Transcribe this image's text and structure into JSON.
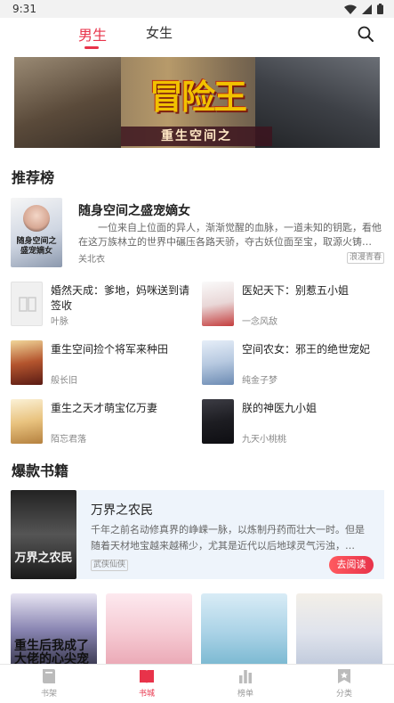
{
  "status": {
    "time": "9:31"
  },
  "tabs": {
    "male": "男生",
    "female": "女生",
    "active": "male"
  },
  "icons": {
    "search": "search-icon",
    "wifi": "wifi-icon",
    "signal": "signal-icon",
    "battery": "battery-icon"
  },
  "banner": {
    "title": "冒险王",
    "subtitle": "重生空间之"
  },
  "recommend": {
    "title": "推荐榜",
    "featured": {
      "cover_text": "随身空间之盛宠嫡女",
      "title": "随身空间之盛宠嫡女",
      "desc": "一位来自上位面的异人，渐渐觉醒的血脉，一道未知的钥匙，看他在这万族林立的世界中碾压各路天骄，夺古妖位面至宝，取源火铸…",
      "author": "关北衣",
      "tag": "浪漫青春"
    },
    "books": [
      {
        "title": "婚然天成：爹地，妈咪送到请签收",
        "author": "叶脉"
      },
      {
        "title": "医妃天下：别惹五小姐",
        "author": "一念风敌"
      },
      {
        "title": "重生空间捡个将军来种田",
        "author": "般长旧"
      },
      {
        "title": "空间农女：邪王的绝世宠妃",
        "author": "纯金子梦"
      },
      {
        "title": "重生之天才萌宝亿万妻",
        "author": "陌忘君落"
      },
      {
        "title": "朕的神医九小姐",
        "author": "九天小桃桃"
      }
    ]
  },
  "hot": {
    "title": "爆款书籍",
    "card": {
      "cover_text": "万界之农民",
      "title": "万界之农民",
      "desc": "千年之前名动修真界的峥嵘一脉，以炼制丹药而壮大一时。但是随着天材地宝越来越稀少，尤其是近代以后地球灵气污浊，…",
      "tag": "武侠仙侠",
      "button": "去阅读"
    },
    "cover_texts": [
      "重生后我成了大佬的心尖宠"
    ]
  },
  "nav": {
    "items": [
      {
        "label": "书架",
        "icon": "bookshelf-icon"
      },
      {
        "label": "书城",
        "icon": "bookstore-icon"
      },
      {
        "label": "榜单",
        "icon": "ranking-icon"
      },
      {
        "label": "分类",
        "icon": "category-icon"
      }
    ],
    "active": 1
  },
  "colors": {
    "accent": "#e8334a",
    "card_bg": "#eef4fb"
  }
}
